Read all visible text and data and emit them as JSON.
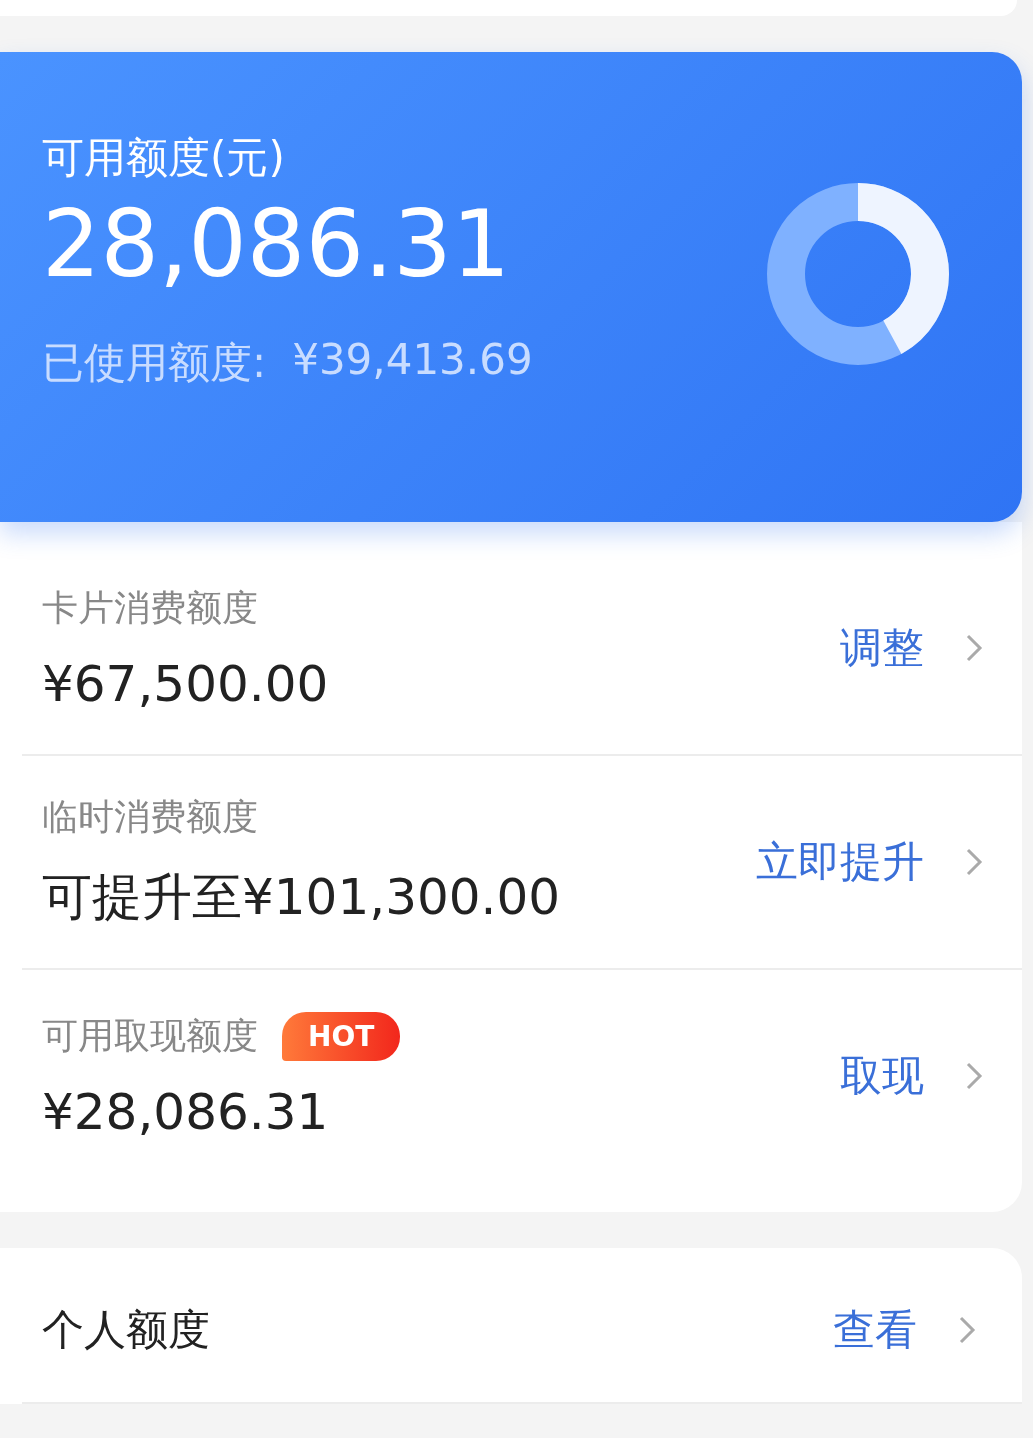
{
  "summary": {
    "label": "可用额度(元)",
    "amount": "28,086.31",
    "used_label": "已使用额度:",
    "used_amount": "¥39,413.69",
    "donut": {
      "level": 0.42
    }
  },
  "limits": [
    {
      "label": "卡片消费额度",
      "value": "¥67,500.00",
      "action": "调整"
    },
    {
      "label": "临时消费额度",
      "value": "可提升至¥101,300.00",
      "action": "立即提升"
    },
    {
      "label": "可用取现额度",
      "value": "¥28,086.31",
      "action": "取现",
      "badge": "HOT"
    }
  ],
  "personal": {
    "label": "个人额度",
    "action": "查看"
  }
}
